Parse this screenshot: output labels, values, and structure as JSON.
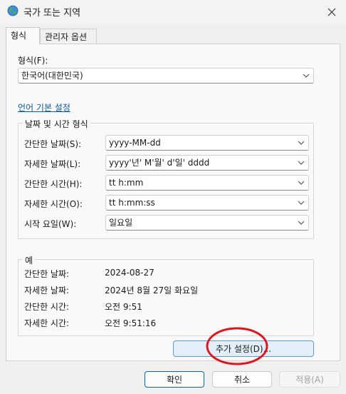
{
  "window": {
    "title": "국가 또는 지역",
    "icon": "globe-icon",
    "close_icon": "close-icon"
  },
  "tabs": [
    {
      "label": "형식",
      "active": true
    },
    {
      "label": "관리자 옵션",
      "active": false
    }
  ],
  "format": {
    "label": "형식(F):",
    "value": "한국어(대한민국)"
  },
  "language_link": "언어 기본 설정",
  "datetime_group": {
    "title": "날짜 및 시간 형식",
    "rows": [
      {
        "label": "간단한 날짜(S):",
        "value": "yyyy-MM-dd"
      },
      {
        "label": "자세한 날짜(L):",
        "value": "yyyy'년' M'월' d'일' dddd"
      },
      {
        "label": "간단한 시간(H):",
        "value": "tt h:mm"
      },
      {
        "label": "자세한 시간(O):",
        "value": "tt h:mm:ss"
      },
      {
        "label": "시작 요일(W):",
        "value": "일요일"
      }
    ]
  },
  "example_group": {
    "title": "예",
    "rows": [
      {
        "label": "간단한 날짜:",
        "value": "2024-08-27"
      },
      {
        "label": "자세한 날짜:",
        "value": "2024년 8월 27일 화요일"
      },
      {
        "label": "간단한 시간:",
        "value": "오전 9:51"
      },
      {
        "label": "자세한 시간:",
        "value": "오전 9:51:16"
      }
    ]
  },
  "additional_settings_button": "추가 설정(D)...",
  "footer": {
    "ok": "확인",
    "cancel": "취소",
    "apply": "적용(A)"
  },
  "colors": {
    "accent": "#0067c0",
    "link": "#0b5ca8",
    "annotation": "#e0161e"
  }
}
